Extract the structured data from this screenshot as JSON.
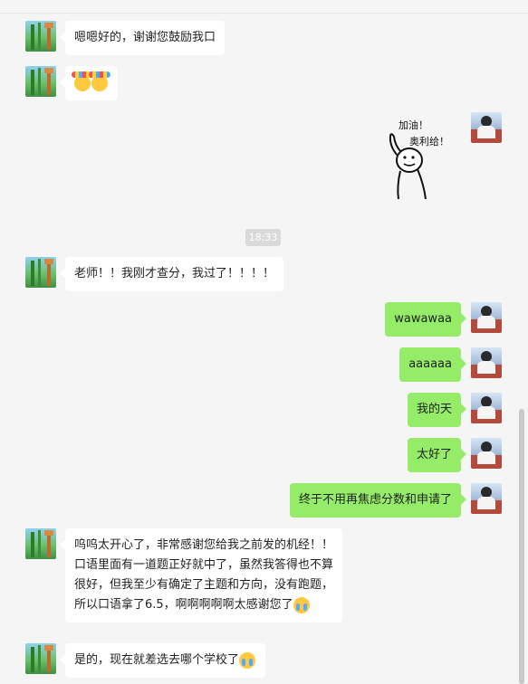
{
  "chat": {
    "timestamp": "18:33",
    "messages": [
      {
        "side": "left",
        "text": "嗯嗯好的，谢谢您鼓励我口"
      },
      {
        "side": "left",
        "emoji": "party-face x2"
      },
      {
        "side": "right",
        "sticker_text_line1": "加油！",
        "sticker_text_line2": "奥利给！"
      },
      {
        "side": "left",
        "text": "老师！！我刚才查分，我过了！！！！"
      },
      {
        "side": "right",
        "text": "wawawaa"
      },
      {
        "side": "right",
        "text": "aaaaaa"
      },
      {
        "side": "right",
        "text": "我的天"
      },
      {
        "side": "right",
        "text": "太好了"
      },
      {
        "side": "right",
        "text": "终于不用再焦虑分数和申请了"
      },
      {
        "side": "left",
        "text": "呜呜太开心了，非常感谢您给我之前发的机经！！口语里面有一道题正好就中了，虽然我答得也不算很好，但我至少有确定了主题和方向，没有跑题，所以口语拿了6.5，啊啊啊啊啊太感谢您了",
        "emoji": "crying-face"
      },
      {
        "side": "left",
        "text": "是的，现在就差选去哪个学校了",
        "emoji": "crying-face"
      }
    ]
  },
  "colors": {
    "sent_bubble": "#95ec69",
    "received_bubble": "#ffffff",
    "background": "#f5f5f5"
  }
}
